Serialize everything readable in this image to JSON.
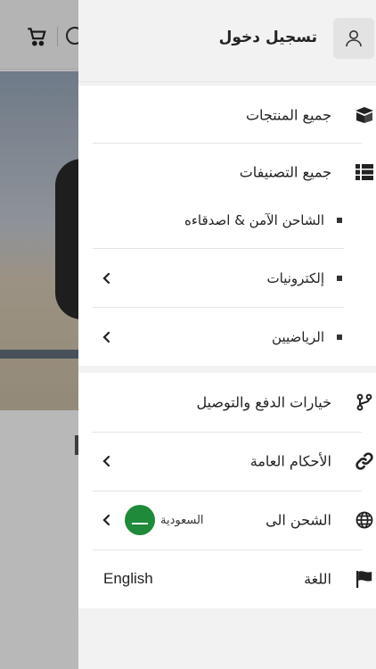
{
  "drawer": {
    "login_label": "تسجيل دخول",
    "all_products": "جميع المنتجات",
    "all_categories": "جميع التصنيفات",
    "categories": [
      {
        "label": "الشاحن الآمن & اصدقاءه",
        "has_children": false
      },
      {
        "label": "إلكترونيات",
        "has_children": true
      },
      {
        "label": "الرياضيين",
        "has_children": true
      }
    ],
    "payment_shipping": "خيارات الدفع والتوصيل",
    "terms": "الأحكام العامة",
    "ship_to_label": "الشحن الى",
    "ship_to_country": "السعودية",
    "language_label": "اللغة",
    "language_value": "English"
  },
  "icons": {
    "user": "user-icon",
    "products": "box-icon",
    "categories": "list-icon",
    "payment": "route-icon",
    "terms": "link-icon",
    "ship": "globe-icon",
    "language": "flag-icon",
    "chevron": "chevron-left-icon",
    "cart": "cart-icon",
    "search": "search-icon"
  },
  "colors": {
    "drawer_bg": "#f2f2f2",
    "flag_green": "#1e8a3a",
    "overlay": "rgba(0,0,0,0.28)"
  }
}
